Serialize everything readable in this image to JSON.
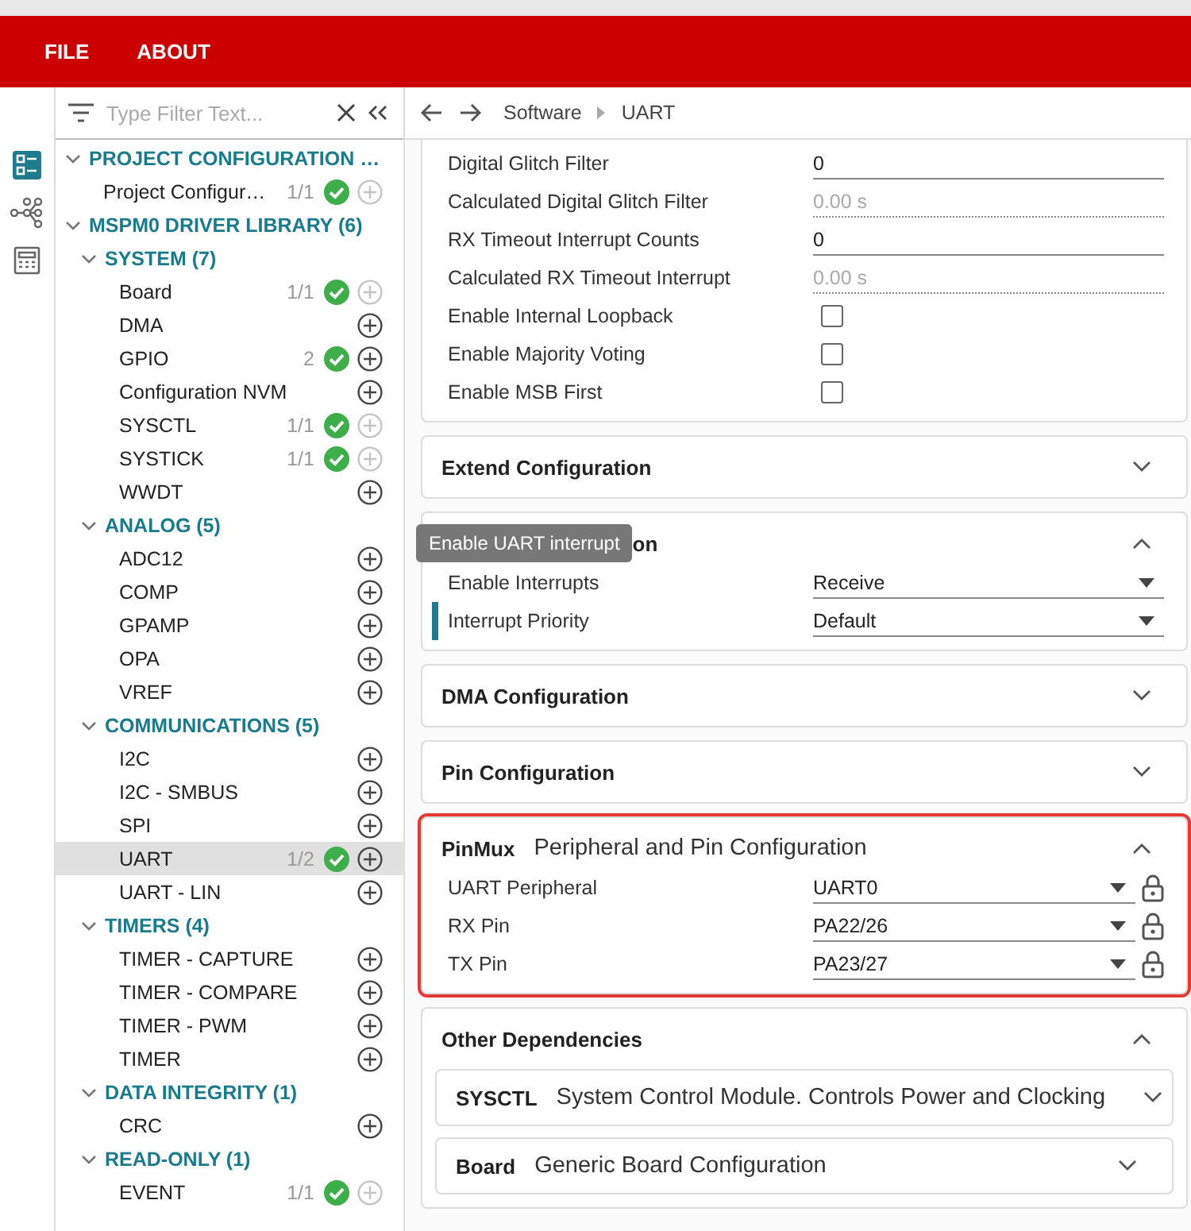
{
  "menu": [
    {
      "label": "FILE"
    },
    {
      "label": "ABOUT"
    }
  ],
  "rail": [
    {
      "kind": "list",
      "selected": true
    },
    {
      "kind": "tree",
      "selected": false
    },
    {
      "kind": "calculator",
      "selected": false
    }
  ],
  "filter": {
    "placeholder": "Type Filter Text..."
  },
  "tree": [
    {
      "kind": "group",
      "label": "PROJECT CONFIGURATION …",
      "expanded": true,
      "children": [
        {
          "kind": "module",
          "label": "Project Configur…",
          "count": "1/1",
          "done": true,
          "add_disabled": true,
          "selected": false
        }
      ]
    },
    {
      "kind": "group",
      "label": "MSPM0 DRIVER LIBRARY (6)",
      "expanded": true,
      "children": [
        {
          "kind": "group",
          "label": "SYSTEM (7)",
          "expanded": true,
          "children": [
            {
              "kind": "module",
              "label": "Board",
              "count": "1/1",
              "done": true,
              "add_disabled": true,
              "selected": false
            },
            {
              "kind": "module",
              "label": "DMA",
              "done": false,
              "add_disabled": false,
              "selected": false
            },
            {
              "kind": "module",
              "label": "GPIO",
              "count": "2",
              "done": true,
              "add_disabled": false,
              "selected": false
            },
            {
              "kind": "module",
              "label": "Configuration NVM",
              "done": false,
              "add_disabled": false,
              "selected": false
            },
            {
              "kind": "module",
              "label": "SYSCTL",
              "count": "1/1",
              "done": true,
              "add_disabled": true,
              "selected": false
            },
            {
              "kind": "module",
              "label": "SYSTICK",
              "count": "1/1",
              "done": true,
              "add_disabled": true,
              "selected": false
            },
            {
              "kind": "module",
              "label": "WWDT",
              "done": false,
              "add_disabled": false,
              "selected": false
            }
          ]
        },
        {
          "kind": "group",
          "label": "ANALOG (5)",
          "expanded": true,
          "children": [
            {
              "kind": "module",
              "label": "ADC12",
              "done": false,
              "add_disabled": false,
              "selected": false
            },
            {
              "kind": "module",
              "label": "COMP",
              "done": false,
              "add_disabled": false,
              "selected": false
            },
            {
              "kind": "module",
              "label": "GPAMP",
              "done": false,
              "add_disabled": false,
              "selected": false
            },
            {
              "kind": "module",
              "label": "OPA",
              "done": false,
              "add_disabled": false,
              "selected": false
            },
            {
              "kind": "module",
              "label": "VREF",
              "done": false,
              "add_disabled": false,
              "selected": false
            }
          ]
        },
        {
          "kind": "group",
          "label": "COMMUNICATIONS (5)",
          "expanded": true,
          "children": [
            {
              "kind": "module",
              "label": "I2C",
              "done": false,
              "add_disabled": false,
              "selected": false
            },
            {
              "kind": "module",
              "label": "I2C - SMBUS",
              "done": false,
              "add_disabled": false,
              "selected": false
            },
            {
              "kind": "module",
              "label": "SPI",
              "done": false,
              "add_disabled": false,
              "selected": false
            },
            {
              "kind": "module",
              "label": "UART",
              "count": "1/2",
              "done": true,
              "add_disabled": false,
              "selected": true
            },
            {
              "kind": "module",
              "label": "UART - LIN",
              "done": false,
              "add_disabled": false,
              "selected": false
            }
          ]
        },
        {
          "kind": "group",
          "label": "TIMERS (4)",
          "expanded": true,
          "children": [
            {
              "kind": "module",
              "label": "TIMER - CAPTURE",
              "done": false,
              "add_disabled": false,
              "selected": false
            },
            {
              "kind": "module",
              "label": "TIMER - COMPARE",
              "done": false,
              "add_disabled": false,
              "selected": false
            },
            {
              "kind": "module",
              "label": "TIMER - PWM",
              "done": false,
              "add_disabled": false,
              "selected": false
            },
            {
              "kind": "module",
              "label": "TIMER",
              "done": false,
              "add_disabled": false,
              "selected": false
            }
          ]
        },
        {
          "kind": "group",
          "label": "DATA INTEGRITY (1)",
          "expanded": true,
          "children": [
            {
              "kind": "module",
              "label": "CRC",
              "done": false,
              "add_disabled": false,
              "selected": false
            }
          ]
        },
        {
          "kind": "group",
          "label": "READ-ONLY (1)",
          "expanded": true,
          "children": [
            {
              "kind": "module",
              "label": "EVENT",
              "count": "1/1",
              "done": true,
              "add_disabled": true,
              "selected": false
            }
          ]
        }
      ]
    }
  ],
  "breadcrumb": [
    "Software",
    "UART"
  ],
  "cards": [
    {
      "expanded": true,
      "highlighted": false,
      "fields": [
        {
          "kind": "text",
          "label": "Digital Glitch Filter",
          "value": "0"
        },
        {
          "kind": "readonly",
          "label": "Calculated Digital Glitch Filter",
          "value": "0.00 s"
        },
        {
          "kind": "text",
          "label": "RX Timeout Interrupt Counts",
          "value": "0"
        },
        {
          "kind": "readonly",
          "label": "Calculated RX Timeout Interrupt",
          "value": "0.00 s"
        },
        {
          "kind": "checkbox",
          "label": "Enable Internal Loopback",
          "checked": false
        },
        {
          "kind": "checkbox",
          "label": "Enable Majority Voting",
          "checked": false
        },
        {
          "kind": "checkbox",
          "label": "Enable MSB First",
          "checked": false
        }
      ]
    },
    {
      "title": "Extend Configuration",
      "expanded": false,
      "highlighted": false
    },
    {
      "title": "on",
      "tooltip": "Enable UART interrupt",
      "expanded": true,
      "highlighted": false,
      "fields": [
        {
          "kind": "select",
          "label": "Enable Interrupts",
          "value": "Receive",
          "focused": false,
          "lock": false
        },
        {
          "kind": "select",
          "label": "Interrupt Priority",
          "value": "Default",
          "focused": true,
          "lock": false
        }
      ]
    },
    {
      "title": "DMA Configuration",
      "expanded": false,
      "highlighted": false
    },
    {
      "title": "Pin Configuration",
      "expanded": false,
      "highlighted": false
    },
    {
      "tag": "PinMux",
      "subtitle": "Peripheral and Pin Configuration",
      "expanded": true,
      "highlighted": true,
      "fields": [
        {
          "kind": "select",
          "label": "UART Peripheral",
          "value": "UART0",
          "focused": false,
          "lock": true
        },
        {
          "kind": "select",
          "label": "RX Pin",
          "value": "PA22/26",
          "focused": false,
          "lock": true
        },
        {
          "kind": "select",
          "label": "TX Pin",
          "value": "PA23/27",
          "focused": false,
          "lock": true
        }
      ]
    },
    {
      "title": "Other Dependencies",
      "expanded": true,
      "highlighted": false,
      "subcards": [
        {
          "tag": "SYSCTL",
          "subtitle": "System Control Module. Controls Power and Clocking",
          "expanded": false
        },
        {
          "tag": "Board",
          "subtitle": "Generic Board Configuration",
          "expanded": false
        }
      ]
    }
  ]
}
